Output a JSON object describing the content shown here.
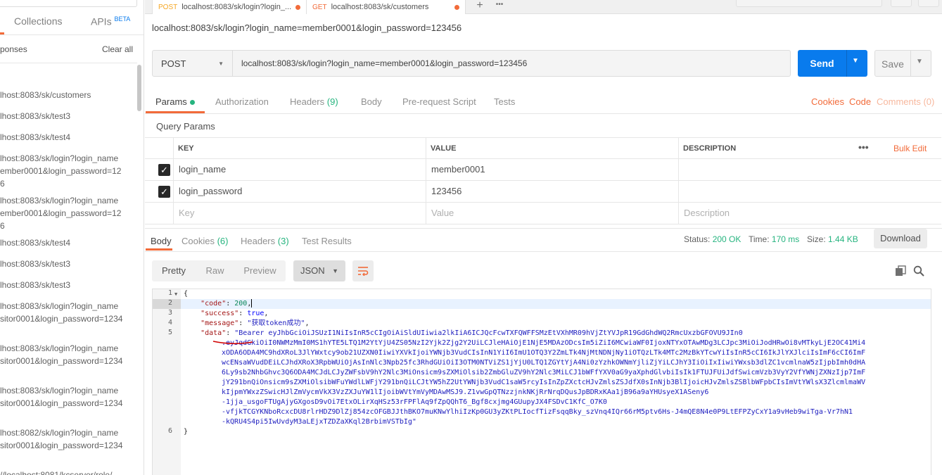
{
  "sidebar": {
    "tabs": [
      "Collections",
      "APIs"
    ],
    "beta_badge": "BETA",
    "history_label": "ponses",
    "clear_all": "Clear all",
    "items": [
      [
        "lhost:8083/sk/customers"
      ],
      [
        "lhost:8083/sk/test3"
      ],
      [
        "lhost:8083/sk/test4"
      ],
      [
        "lhost:8083/sk/login?login_name",
        "ember0001&login_password=12",
        "6"
      ],
      [
        "lhost:8083/sk/login?login_name",
        "ember0001&login_password=12",
        "6"
      ],
      [
        "lhost:8083/sk/test4"
      ],
      [
        "lhost:8083/sk/test3"
      ],
      [
        "lhost:8083/sk/test3"
      ],
      [
        "lhost:8083/sk/login?login_name",
        "sitor0001&login_password=1234"
      ],
      [
        "lhost:8083/sk/login?login_name",
        "sitor0001&login_password=1234"
      ],
      [
        "lhost:8083/sk/login?login_name",
        "sitor0001&login_password=1234"
      ],
      [
        "lhost:8082/sk/login?login_name",
        "sitor0001&login_password=1234"
      ],
      [
        "//localhost:8081/kcserver/role/"
      ]
    ]
  },
  "tabs": [
    {
      "method": "POST",
      "title": "localhost:8083/sk/login?login_..."
    },
    {
      "method": "GET",
      "title": "localhost:8083/sk/customers"
    }
  ],
  "tabbar": {
    "add": "+",
    "more": "•••"
  },
  "request": {
    "title": "localhost:8083/sk/login?login_name=member0001&login_password=123456",
    "method": "POST",
    "url": "localhost:8083/sk/login?login_name=member0001&login_password=123456",
    "send_label": "Send",
    "save_label": "Save"
  },
  "request_tabs": {
    "params": "Params",
    "authorization": "Authorization",
    "headers": "Headers",
    "headers_count": "(9)",
    "body": "Body",
    "prerequest": "Pre-request Script",
    "tests": "Tests",
    "cookies": "Cookies",
    "code": "Code",
    "comments": "Comments (0)"
  },
  "query_params": {
    "title": "Query Params",
    "headers": [
      "KEY",
      "VALUE",
      "DESCRIPTION"
    ],
    "bulk_edit": "Bulk Edit",
    "more": "•••",
    "rows": [
      {
        "key": "login_name",
        "value": "member0001",
        "checked": true
      },
      {
        "key": "login_password",
        "value": "123456",
        "checked": true
      }
    ],
    "placeholder": {
      "key": "Key",
      "value": "Value",
      "description": "Description"
    }
  },
  "response": {
    "tabs": {
      "body": "Body",
      "cookies": "Cookies",
      "cookies_count": "(6)",
      "headers": "Headers",
      "headers_count": "(3)",
      "test_results": "Test Results"
    },
    "status_label": "Status:",
    "status": "200 OK",
    "time_label": "Time:",
    "time": "170 ms",
    "size_label": "Size:",
    "size": "1.44 KB",
    "download": "Download",
    "formats": [
      "Pretty",
      "Raw",
      "Preview"
    ],
    "language": "JSON",
    "line_numbers": [
      "1",
      "2",
      "3",
      "4",
      "5",
      "6"
    ],
    "code": {
      "l1": "{",
      "code_key": "\"code\"",
      "code_val": "200",
      "success_key": "\"success\"",
      "success_val": "true",
      "message_key": "\"message\"",
      "message_val": "\"获取token成功\"",
      "data_key": "\"data\"",
      "data_lines": [
        "\"Bearer eyJhbGciOiJSUzI1NiIsInR5cCIgOiAiSldUIiwia2lkIiA6ICJQcFcwTXFQWFFSMzEtVXhMR09hVjZtYVJpR19GdGhdWQ2RmcUxzbGFOVU9JIn0",
        ".eyJqdGkiOiI0NWMzMmI0MS1hYTE5LTQ1M2YtYjU4ZS05NzI2Yjk2Zjg2Y2UiLCJleHAiOjE1NjE5MDAzODcsIm5iZiI6MCwiaWF0IjoxNTYxOTAwMDg3LCJpc3MiOiJodHRwOi8vMTkyLjE2OC41Mi4",
        "xODA6ODA4MC9hdXRoL3JlYWxtcy9ob21UZXN0IiwiYXVkIjoiYWNjb3VudCIsInN1YiI6ImU1OTQ3Y2ZmLTk4NjMtNDNjNy1iOTQzLTk4MTc2MzBkYTcwYiIsInR5cCI6IkJlYXJlciIsImF6cCI6ImF",
        "wcENsaWVudDEiLCJhdXRoX3RpbWUiOjAsInNlc3Npb25fc3RhdGUiOiI3OTM0NTViZS1jYjU0LTQ1ZGYtYjA4Ni0zYzhkOWNmYjliZjYiLCJhY3IiOiIxIiwiYWxsb3dlZC1vcmlnaW5zIjpbImh0dHA",
        "6Ly9sb2NhbGhvc3Q6ODA4MCJdLCJyZWFsbV9hY2Nlc3MiOnsicm9sZXMiOlsib2ZmbGluZV9hY2Nlc3MiLCJ1bWFfYXV0aG9yaXphdGlvbiIsIk1FTUJFUiJdfSwicmVzb3VyY2VfYWNjZXNzIjp7ImF",
        "jY291bnQiOnsicm9sZXMiOlsibWFuYWdlLWFjY291bnQiLCJtYW5hZ2UtYWNjb3VudC1saW5rcyIsInZpZXctcHJvZmlsZSJdfX0sInNjb3BlIjoicHJvZmlsZSBlbWFpbCIsImVtYWlsX3ZlcmlmaWV",
        "kIjpmYWxzZSwicHJlZmVycmVkX3VzZXJuYW1lIjoibWVtYmVyMDAwMSJ9.Z1vwGpQTNzzjnkNKjRrNrqDQusJpBDRxKAa1jB96a9aYHUsyeX1ASeny6",
        "-1jja_usgoFTUgAjyGXgosD9vOi7EtxOLirXqHSz53rFPFlAq9fZpQQhT6_Bgf8cxjmg4GUupyJX4FSDvC1KfC_O7K0",
        "-vfjkTCGYKNboRcxcDU8rlrHDZ9DlZj854zcOFGBJJthBKO7muKNwYlhiIzKp0GU3yZKtPLIocfTizFsqqBky_szVnq4IQr66rM5ptv6Hs-J4mQE8N4e0P9LtEFPZyCxY1a9vHeb9wiTga-Vr7hN1",
        "-kQRU4S4pi5IwUvdyM3aLEjxTZDZaXKql2BrbimVSTbIg\""
      ],
      "l6": "}"
    }
  }
}
